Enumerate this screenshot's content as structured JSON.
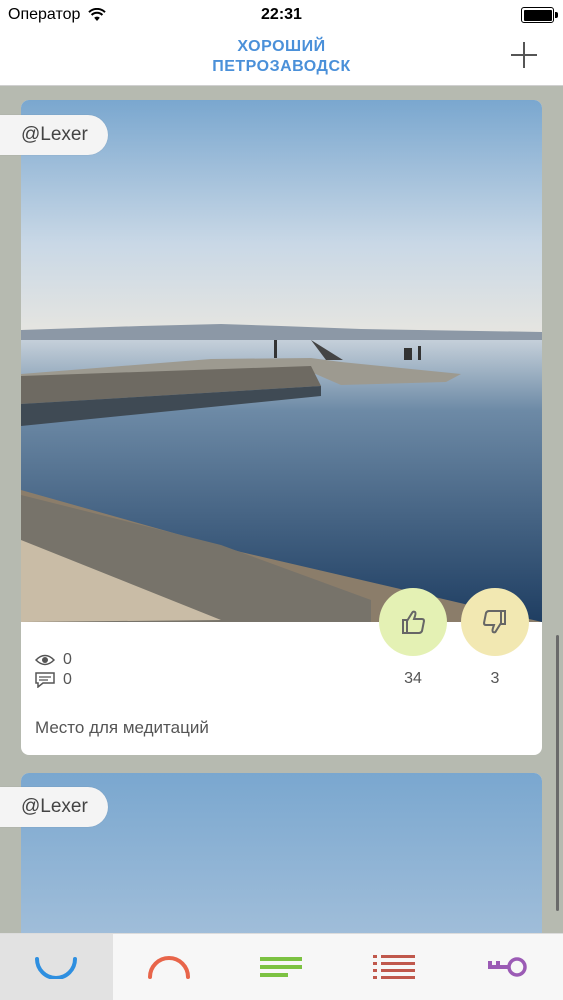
{
  "status_bar": {
    "carrier": "Оператор",
    "time": "22:31"
  },
  "nav": {
    "title_line1": "ХОРОШИЙ",
    "title_line2": "ПЕТРОЗАВОДСК",
    "add_icon": "plus-icon"
  },
  "posts": [
    {
      "author": "@Lexer",
      "views": "0",
      "comments": "0",
      "likes": "34",
      "dislikes": "3",
      "caption": "Место для медитаций"
    },
    {
      "author": "@Lexer"
    }
  ],
  "tabs": [
    {
      "icon": "arc-down-icon",
      "color": "#2e8fe0",
      "active": true
    },
    {
      "icon": "arc-up-icon",
      "color": "#e8654a",
      "active": false
    },
    {
      "icon": "list-green-icon",
      "color": "#7cc242",
      "active": false
    },
    {
      "icon": "list-red-icon",
      "color": "#c0584c",
      "active": false
    },
    {
      "icon": "key-icon",
      "color": "#9b5bb5",
      "active": false
    }
  ],
  "colors": {
    "accent": "#4a90d9",
    "like_bg": "#e4f1b4",
    "dislike_bg": "#f2e8b2"
  }
}
